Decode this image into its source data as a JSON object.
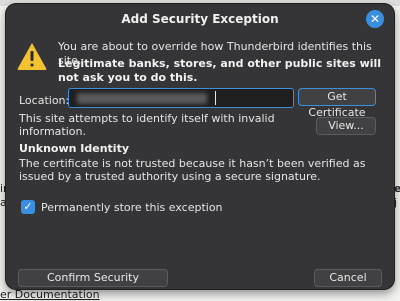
{
  "background": {
    "fragment_left": "ir",
    "fragment_left2": "a",
    "fragment_right": "ev",
    "fragment_right2": "j",
    "footer_link": "er Documentation"
  },
  "dialog": {
    "title": "Add Security Exception",
    "close_icon": "close-icon",
    "warning_icon": "warning-triangle-icon",
    "message": "You are about to override how Thunderbird identifies this site.",
    "warning": "Legitimate banks, stores, and other public sites will not ask you to do this.",
    "location_label": "Location:",
    "get_certificate_label": "Get Certificate",
    "attempt_text": "This site attempts to identify itself with invalid information.",
    "view_label": "View...",
    "unknown_heading": "Unknown Identity",
    "unknown_text": "The certificate is not trusted because it hasn’t been verified as issued by a trusted authority using a secure signature.",
    "permanent_label": "Permanently store this exception",
    "permanent_checked": true,
    "confirm_label": "Confirm Security Exception",
    "cancel_label": "Cancel"
  },
  "colors": {
    "dialog_bg": "#353537",
    "accent": "#3b8fe0",
    "warning": "#f2c230"
  }
}
